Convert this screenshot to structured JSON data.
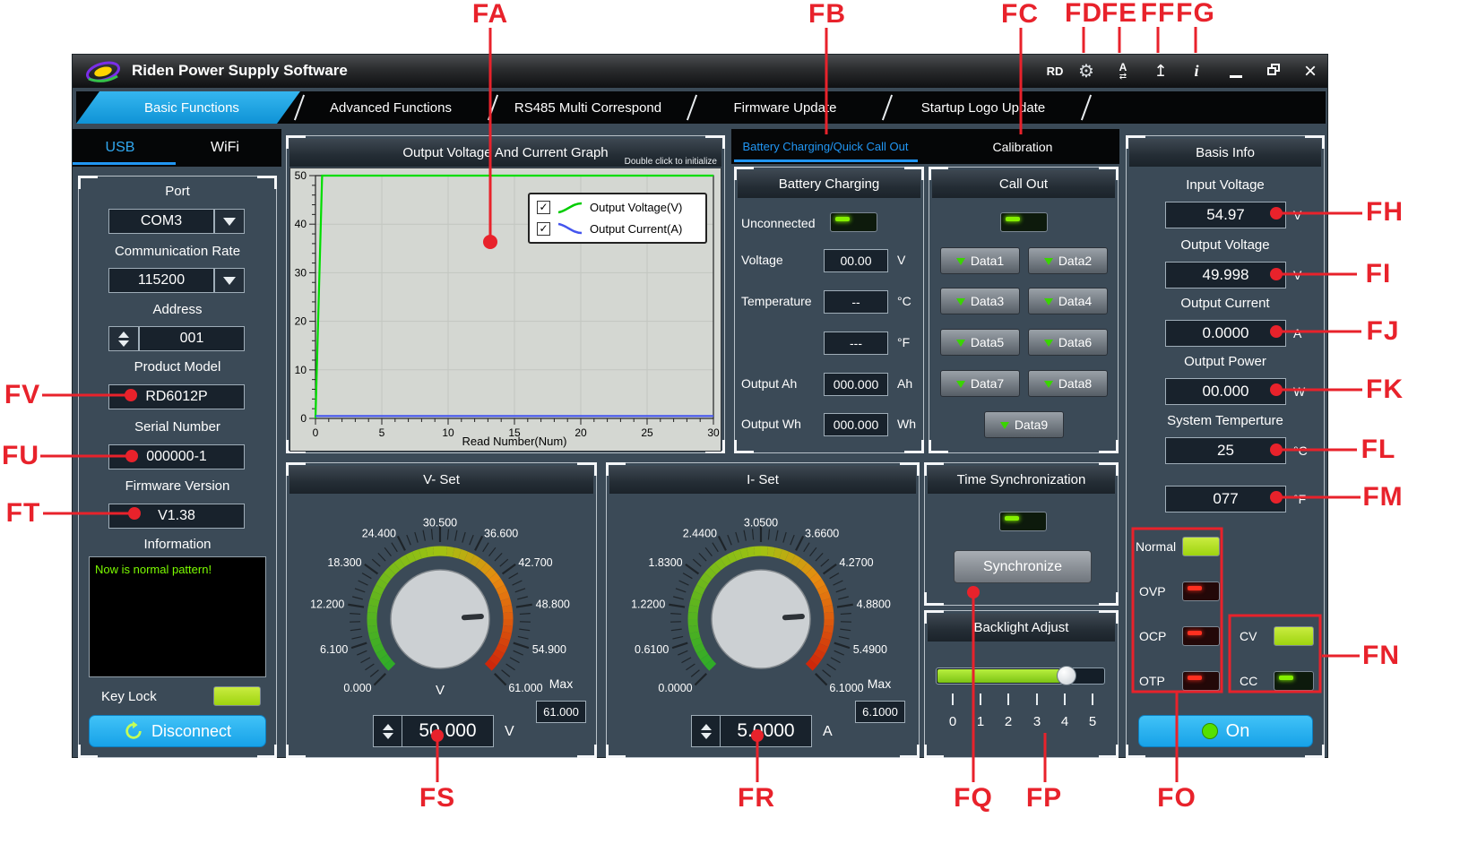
{
  "window": {
    "title": "Riden Power Supply Software",
    "rd_label": "RD"
  },
  "main_tabs": {
    "items": [
      "Basic Functions",
      "Advanced Functions",
      "RS485 Multi Correspond",
      "Firmware Update",
      "Startup Logo Update"
    ],
    "active": "Basic Functions"
  },
  "conn_tabs": {
    "usb": "USB",
    "wifi": "WiFi",
    "active": "USB"
  },
  "left_panel": {
    "port_label": "Port",
    "port_value": "COM3",
    "comm_rate_label": "Communication Rate",
    "comm_rate_value": "115200",
    "address_label": "Address",
    "address_value": "001",
    "product_model_label": "Product Model",
    "product_model_value": "RD6012P",
    "serial_label": "Serial Number",
    "serial_value": "000000-1",
    "firmware_label": "Firmware Version",
    "firmware_value": "V1.38",
    "info_label": "Information",
    "info_text": "Now is normal pattern!",
    "key_lock_label": "Key Lock",
    "disconnect_label": "Disconnect"
  },
  "chart_data": {
    "type": "line",
    "title": "Output Voltage And Current Graph",
    "subtitle": "Double click to initialize",
    "xlabel": "Read Number(Num)",
    "xlim": [
      0,
      30
    ],
    "ylim": [
      0,
      50
    ],
    "xticks": [
      0,
      5,
      10,
      15,
      20,
      25,
      30
    ],
    "yticks": [
      0,
      10,
      20,
      30,
      40,
      50
    ],
    "grid": true,
    "legend_position": "top-right",
    "series": [
      {
        "name": "Output Voltage(V)",
        "color": "#00dd00",
        "checked": true,
        "x": [
          0,
          0.5,
          30
        ],
        "y": [
          0,
          50,
          50
        ]
      },
      {
        "name": "Output Current(A)",
        "color": "#4455ee",
        "checked": true,
        "x": [
          0,
          30
        ],
        "y": [
          0.5,
          0.5
        ]
      }
    ]
  },
  "sub_tabs": {
    "battery": "Battery Charging/Quick Call Out",
    "calibration": "Calibration",
    "active": "Battery Charging/Quick Call Out"
  },
  "battery_charging": {
    "title": "Battery Charging",
    "status_label": "Unconnected",
    "rows": [
      {
        "label": "Voltage",
        "value": "00.00",
        "unit": "V"
      },
      {
        "label": "Temperature",
        "value": "--",
        "unit": "°C"
      },
      {
        "label": "",
        "value": "---",
        "unit": "°F"
      },
      {
        "label": "Output Ah",
        "value": "000.000",
        "unit": "Ah"
      },
      {
        "label": "Output Wh",
        "value": "000.000",
        "unit": "Wh"
      }
    ]
  },
  "call_out": {
    "title": "Call Out",
    "buttons": [
      "Data1",
      "Data2",
      "Data3",
      "Data4",
      "Data5",
      "Data6",
      "Data7",
      "Data8",
      "Data9"
    ]
  },
  "v_set": {
    "title": "V- Set",
    "scale": [
      "0.000",
      "6.100",
      "12.200",
      "18.300",
      "24.400",
      "30.500",
      "36.600",
      "42.700",
      "48.800",
      "54.900",
      "61.000"
    ],
    "knob_unit": "V",
    "max_label": "Max",
    "max_value": "61.000",
    "value": "50.000",
    "unit": "V"
  },
  "i_set": {
    "title": "I- Set",
    "scale": [
      "0.0000",
      "0.6100",
      "1.2200",
      "1.8300",
      "2.4400",
      "3.0500",
      "3.6600",
      "4.2700",
      "4.8800",
      "5.4900",
      "6.1000"
    ],
    "knob_unit": "",
    "max_label": "Max",
    "max_value": "6.1000",
    "value": "5.0000",
    "unit": "A"
  },
  "time_sync": {
    "title": "Time Synchronization",
    "button_label": "Synchronize"
  },
  "backlight": {
    "title": "Backlight Adjust",
    "ticks": [
      "0",
      "1",
      "2",
      "3",
      "4",
      "5"
    ],
    "value": 4,
    "max": 5
  },
  "basis_info": {
    "title": "Basis Info",
    "rows": [
      {
        "label": "Input Voltage",
        "value": "54.97",
        "unit": "V"
      },
      {
        "label": "Output Voltage",
        "value": "49.998",
        "unit": "V"
      },
      {
        "label": "Output Current",
        "value": "0.0000",
        "unit": "A"
      },
      {
        "label": "Output Power",
        "value": "00.000",
        "unit": "W"
      },
      {
        "label": "System Temperture",
        "value": "25",
        "unit": "°C"
      },
      {
        "label": "",
        "value": "077",
        "unit": "°F"
      }
    ],
    "protection_indicators": [
      {
        "label": "Normal",
        "on": true,
        "color": "green"
      },
      {
        "label": "OVP",
        "on": false,
        "color": "red"
      },
      {
        "label": "OCP",
        "on": false,
        "color": "red"
      },
      {
        "label": "OTP",
        "on": false,
        "color": "red"
      }
    ],
    "mode_indicators": [
      {
        "label": "CV",
        "on": true,
        "color": "green"
      },
      {
        "label": "CC",
        "on": false,
        "color": "green"
      }
    ],
    "on_button_label": "On"
  },
  "colors": {
    "accent_blue": "#29b6f6",
    "tab_blue": "#1aa7e8",
    "voltage_line": "#00dd00",
    "current_line": "#4455ee",
    "led_on": "#aadd22",
    "annotation_red": "#e8222b"
  },
  "annotations": {
    "color": "#e8222b",
    "items": [
      "FA",
      "FB",
      "FC",
      "FD",
      "FE",
      "FF",
      "FG",
      "FH",
      "FI",
      "FJ",
      "FK",
      "FL",
      "FM",
      "FN",
      "FO",
      "FP",
      "FQ",
      "FR",
      "FS",
      "FT",
      "FU",
      "FV"
    ]
  }
}
